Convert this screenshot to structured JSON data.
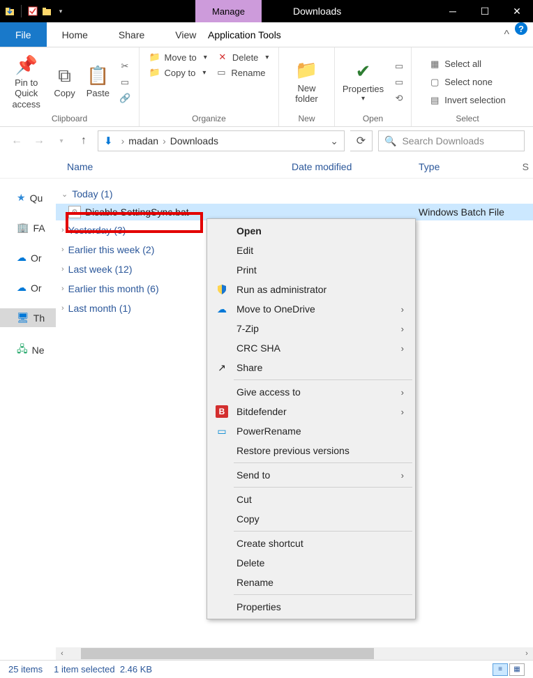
{
  "titlebar": {
    "manage": "Manage",
    "title": "Downloads"
  },
  "tabs": {
    "file": "File",
    "home": "Home",
    "share": "Share",
    "view": "View",
    "apptools": "Application Tools"
  },
  "ribbon": {
    "clipboard": {
      "label": "Clipboard",
      "pin": "Pin to Quick\naccess",
      "copy": "Copy",
      "paste": "Paste"
    },
    "organize": {
      "label": "Organize",
      "moveto": "Move to",
      "copyto": "Copy to",
      "delete": "Delete",
      "rename": "Rename"
    },
    "new": {
      "label": "New",
      "newfolder": "New\nfolder"
    },
    "open": {
      "label": "Open",
      "properties": "Properties"
    },
    "select": {
      "label": "Select",
      "all": "Select all",
      "none": "Select none",
      "invert": "Invert selection"
    }
  },
  "breadcrumb": {
    "seg1": "madan",
    "seg2": "Downloads"
  },
  "search": {
    "placeholder": "Search Downloads"
  },
  "columns": {
    "name": "Name",
    "date": "Date modified",
    "type": "Type",
    "s": "S"
  },
  "tree": {
    "quick": "Qu",
    "fav": "FA",
    "one1": "Or",
    "one2": "Or",
    "thispc": "Th",
    "network": "Ne"
  },
  "groups": {
    "today": "Today (1)",
    "yesterday": "Yesterday (3)",
    "earlierweek": "Earlier this week (2)",
    "lastweek": "Last week (12)",
    "earliermonth": "Earlier this month (6)",
    "lastmonth": "Last month (1)"
  },
  "file": {
    "name": "Disable SettingSync.bat",
    "type": "Windows Batch File"
  },
  "ctx": {
    "open": "Open",
    "edit": "Edit",
    "print": "Print",
    "runas": "Run as administrator",
    "onedrive": "Move to OneDrive",
    "sevenzip": "7-Zip",
    "crcsha": "CRC SHA",
    "share": "Share",
    "giveaccess": "Give access to",
    "bitdefender": "Bitdefender",
    "powerrename": "PowerRename",
    "restore": "Restore previous versions",
    "sendto": "Send to",
    "cut": "Cut",
    "copy": "Copy",
    "shortcut": "Create shortcut",
    "delete": "Delete",
    "rename": "Rename",
    "properties": "Properties"
  },
  "status": {
    "items": "25 items",
    "selected": "1 item selected",
    "size": "2.46 KB"
  }
}
